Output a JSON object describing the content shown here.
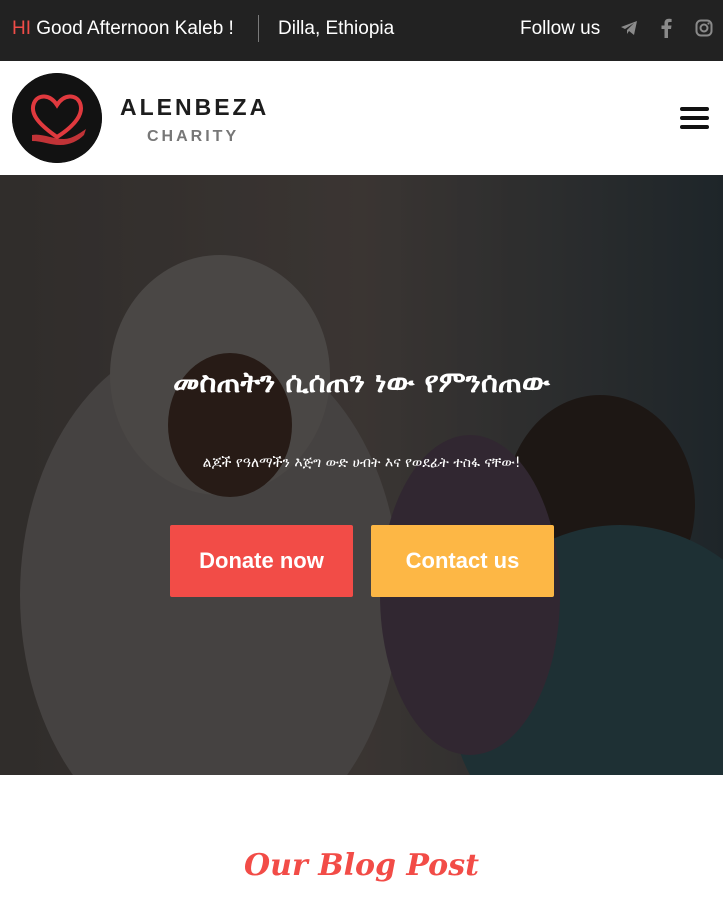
{
  "topbar": {
    "greeting_hi": "HI",
    "greeting_text": "Good Afternoon Kaleb !",
    "location": "Dilla, Ethiopia",
    "follow_label": "Follow us",
    "social_icons": [
      "telegram-icon",
      "facebook-icon",
      "instagram-icon"
    ]
  },
  "header": {
    "brand_name": "ALENBEZA",
    "brand_sub": "CHARITY"
  },
  "hero": {
    "title": "መስጠትን ሲሰጠን ነው የምንሰጠው",
    "subtitle": "ልጆች የዓለማችን እጅግ ውድ ሀብት እና የወደፊት ተስፋ ናቸው!",
    "donate_label": "Donate now",
    "contact_label": "Contact us"
  },
  "blog": {
    "title": "Our Blog Post"
  },
  "colors": {
    "accent_red": "#f24c47",
    "accent_yellow": "#fdb745",
    "topbar_bg": "#222222"
  }
}
